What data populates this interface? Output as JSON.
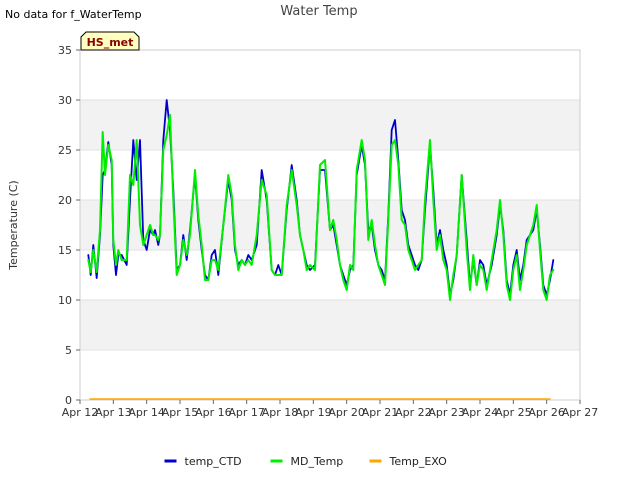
{
  "note_top_left": "No data for f_WaterTemp",
  "badge": "HS_met",
  "chart_data": {
    "type": "line",
    "title": "Water Temp",
    "xlabel": "",
    "ylabel": "Temperature (C)",
    "xlim": [
      12,
      27
    ],
    "ylim": [
      0,
      35
    ],
    "x_ticks": [
      12,
      13,
      14,
      15,
      16,
      17,
      18,
      19,
      20,
      21,
      22,
      23,
      24,
      25,
      26,
      27
    ],
    "x_tick_labels": [
      "Apr 12",
      "Apr 13",
      "Apr 14",
      "Apr 15",
      "Apr 16",
      "Apr 17",
      "Apr 18",
      "Apr 19",
      "Apr 20",
      "Apr 21",
      "Apr 22",
      "Apr 23",
      "Apr 24",
      "Apr 25",
      "Apr 26",
      "Apr 27"
    ],
    "y_ticks": [
      0,
      5,
      10,
      15,
      20,
      25,
      30,
      35
    ],
    "grid": "horizontal bands",
    "legend_position": "bottom-center",
    "series": [
      {
        "name": "temp_CTD",
        "color": "#0000cc",
        "x": [
          12.25,
          12.32,
          12.4,
          12.5,
          12.6,
          12.68,
          12.75,
          12.85,
          12.95,
          13.0,
          13.08,
          13.15,
          13.25,
          13.4,
          13.5,
          13.6,
          13.7,
          13.8,
          13.9,
          14.0,
          14.1,
          14.2,
          14.25,
          14.35,
          14.4,
          14.5,
          14.6,
          14.7,
          14.8,
          14.9,
          15.0,
          15.1,
          15.2,
          15.3,
          15.45,
          15.55,
          15.65,
          15.75,
          15.85,
          15.95,
          16.05,
          16.15,
          16.3,
          16.45,
          16.55,
          16.65,
          16.75,
          16.85,
          16.95,
          17.05,
          17.15,
          17.3,
          17.45,
          17.6,
          17.75,
          17.85,
          17.95,
          18.05,
          18.2,
          18.35,
          18.5,
          18.6,
          18.7,
          18.8,
          18.9,
          19.05,
          19.2,
          19.35,
          19.5,
          19.6,
          19.7,
          19.8,
          19.9,
          20.0,
          20.1,
          20.2,
          20.3,
          20.45,
          20.55,
          20.65,
          20.75,
          20.85,
          20.95,
          21.05,
          21.15,
          21.25,
          21.35,
          21.45,
          21.55,
          21.65,
          21.75,
          21.85,
          21.95,
          22.05,
          22.15,
          22.25,
          22.35,
          22.5,
          22.6,
          22.7,
          22.8,
          22.9,
          23.0,
          23.1,
          23.2,
          23.3,
          23.45,
          23.6,
          23.7,
          23.8,
          23.9,
          24.0,
          24.1,
          24.2,
          24.35,
          24.5,
          24.6,
          24.7,
          24.8,
          24.9,
          25.0,
          25.1,
          25.2,
          25.3,
          25.4,
          25.5,
          25.6,
          25.7,
          25.8,
          25.9,
          26.0,
          26.1,
          26.2
        ],
        "y": [
          14.5,
          12.5,
          15.5,
          12.2,
          16.5,
          22.5,
          23.0,
          25.8,
          23.5,
          15.5,
          12.5,
          14.5,
          14.5,
          13.5,
          20.0,
          26.0,
          22.0,
          26.0,
          16.0,
          15.0,
          17.0,
          16.5,
          17.0,
          15.5,
          16.5,
          26.0,
          30.0,
          27.0,
          21.0,
          13.0,
          13.5,
          16.5,
          14.0,
          17.0,
          22.5,
          18.0,
          15.0,
          12.5,
          12.0,
          14.5,
          15.0,
          12.5,
          17.5,
          22.0,
          20.0,
          15.0,
          13.5,
          14.0,
          13.5,
          14.5,
          14.0,
          15.5,
          23.0,
          20.0,
          13.0,
          12.5,
          13.5,
          12.5,
          19.0,
          23.5,
          20.0,
          16.5,
          15.0,
          13.5,
          13.0,
          13.5,
          23.0,
          23.0,
          17.0,
          17.5,
          15.5,
          13.5,
          12.5,
          11.5,
          13.0,
          13.5,
          22.5,
          25.5,
          23.5,
          17.0,
          17.5,
          15.0,
          13.5,
          13.0,
          12.0,
          18.5,
          27.0,
          28.0,
          24.0,
          19.0,
          18.0,
          15.5,
          14.5,
          13.5,
          13.0,
          14.0,
          19.0,
          25.5,
          21.0,
          15.5,
          17.0,
          15.0,
          13.5,
          10.5,
          12.0,
          14.5,
          22.5,
          16.0,
          11.5,
          14.0,
          11.5,
          14.0,
          13.5,
          11.5,
          13.5,
          16.5,
          19.5,
          17.0,
          12.0,
          10.5,
          13.5,
          15.0,
          12.0,
          13.5,
          16.0,
          16.5,
          17.0,
          19.0,
          15.5,
          11.5,
          10.5,
          12.0,
          14.0
        ],
        "line_width": 1.8
      },
      {
        "name": "MD_Temp",
        "color": "#00ee00",
        "x": [
          12.25,
          12.32,
          12.4,
          12.5,
          12.6,
          12.68,
          12.75,
          12.85,
          12.95,
          13.0,
          13.08,
          13.15,
          13.25,
          13.4,
          13.5,
          13.6,
          13.7,
          13.8,
          13.9,
          14.0,
          14.1,
          14.2,
          14.25,
          14.35,
          14.4,
          14.5,
          14.6,
          14.7,
          14.8,
          14.9,
          15.0,
          15.1,
          15.2,
          15.3,
          15.45,
          15.55,
          15.65,
          15.75,
          15.85,
          15.95,
          16.05,
          16.15,
          16.3,
          16.45,
          16.55,
          16.65,
          16.75,
          16.85,
          16.95,
          17.05,
          17.15,
          17.3,
          17.45,
          17.6,
          17.75,
          17.85,
          17.95,
          18.05,
          18.2,
          18.35,
          18.5,
          18.6,
          18.7,
          18.8,
          18.9,
          19.05,
          19.2,
          19.35,
          19.5,
          19.6,
          19.7,
          19.8,
          19.9,
          20.0,
          20.1,
          20.2,
          20.3,
          20.45,
          20.55,
          20.65,
          20.75,
          20.85,
          20.95,
          21.05,
          21.15,
          21.25,
          21.35,
          21.45,
          21.55,
          21.65,
          21.75,
          21.85,
          21.95,
          22.05,
          22.15,
          22.25,
          22.35,
          22.5,
          22.6,
          22.7,
          22.8,
          22.9,
          23.0,
          23.1,
          23.2,
          23.3,
          23.45,
          23.6,
          23.7,
          23.8,
          23.9,
          24.0,
          24.1,
          24.2,
          24.35,
          24.5,
          24.6,
          24.7,
          24.8,
          24.9,
          25.0,
          25.1,
          25.2,
          25.3,
          25.4,
          25.5,
          25.6,
          25.7,
          25.8,
          25.9,
          26.0,
          26.1,
          26.2
        ],
        "y": [
          14.0,
          12.8,
          15.0,
          12.8,
          17.0,
          26.8,
          22.5,
          25.5,
          24.0,
          16.0,
          13.5,
          15.0,
          14.0,
          14.0,
          22.5,
          21.5,
          26.0,
          17.5,
          15.5,
          16.5,
          17.5,
          16.5,
          16.5,
          16.0,
          16.5,
          25.0,
          26.5,
          28.5,
          20.0,
          12.5,
          13.5,
          16.0,
          14.5,
          16.5,
          23.0,
          18.5,
          15.5,
          12.0,
          12.0,
          14.0,
          14.0,
          13.0,
          17.5,
          22.5,
          20.5,
          15.5,
          13.0,
          14.0,
          13.5,
          14.0,
          13.5,
          16.5,
          22.0,
          20.5,
          13.0,
          12.5,
          12.5,
          12.5,
          19.5,
          23.0,
          19.5,
          16.5,
          15.0,
          13.0,
          13.5,
          13.0,
          23.5,
          24.0,
          17.0,
          18.0,
          16.0,
          13.5,
          12.0,
          11.0,
          13.5,
          13.0,
          23.0,
          26.0,
          24.0,
          16.0,
          18.0,
          15.5,
          13.5,
          12.5,
          11.5,
          18.0,
          25.5,
          26.0,
          23.5,
          18.0,
          17.5,
          15.0,
          14.0,
          13.0,
          13.5,
          14.0,
          20.0,
          26.0,
          20.0,
          15.0,
          16.5,
          14.0,
          13.0,
          10.0,
          12.5,
          14.5,
          22.5,
          15.0,
          11.0,
          14.5,
          11.5,
          13.5,
          13.0,
          11.0,
          14.0,
          17.0,
          20.0,
          16.5,
          11.5,
          10.0,
          13.0,
          14.5,
          11.0,
          13.0,
          15.5,
          16.5,
          17.5,
          19.5,
          15.0,
          11.0,
          10.0,
          12.5,
          13.0
        ],
        "line_width": 2.0
      },
      {
        "name": "Temp_EXO",
        "color": "#ffa500",
        "x": [
          12.3,
          26.1
        ],
        "y": [
          0.1,
          0.1
        ],
        "line_width": 1.5
      }
    ]
  }
}
